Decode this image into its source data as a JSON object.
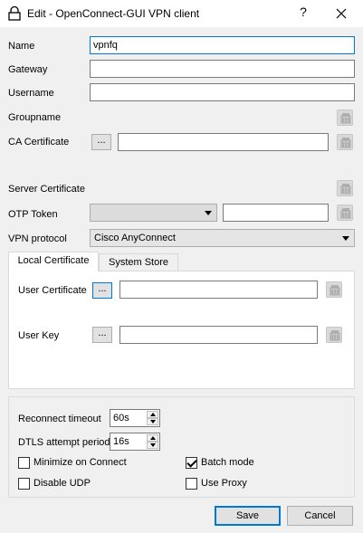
{
  "window": {
    "title": "Edit - OpenConnect-GUI VPN client",
    "help_label": "?"
  },
  "form": {
    "name_label": "Name",
    "name_value": "vpnfq",
    "gateway_label": "Gateway",
    "gateway_value": "",
    "username_label": "Username",
    "username_value": "",
    "groupname_label": "Groupname",
    "ca_certificate_label": "CA Certificate",
    "ca_certificate_value": "",
    "browse_label": "...",
    "server_certificate_label": "Server Certificate",
    "otp_token_label": "OTP Token",
    "otp_token_type": "",
    "otp_token_value": "",
    "vpn_protocol_label": "VPN protocol",
    "vpn_protocol_value": "Cisco AnyConnect"
  },
  "tabs": [
    {
      "label": "Local Certificate",
      "active": true
    },
    {
      "label": "System Store",
      "active": false
    }
  ],
  "local_certificate": {
    "user_certificate_label": "User Certificate",
    "user_certificate_value": "",
    "user_key_label": "User Key",
    "user_key_value": ""
  },
  "options": {
    "reconnect_timeout_label": "Reconnect timeout",
    "reconnect_timeout_value": "60s",
    "dtls_attempt_label": "DTLS attempt period",
    "dtls_attempt_value": "16s",
    "minimize_on_connect_label": "Minimize on Connect",
    "minimize_on_connect": false,
    "batch_mode_label": "Batch mode",
    "batch_mode": true,
    "disable_udp_label": "Disable UDP",
    "disable_udp": false,
    "use_proxy_label": "Use Proxy",
    "use_proxy": false
  },
  "buttons": {
    "save_label": "Save",
    "cancel_label": "Cancel"
  },
  "icons": {
    "window_icon": "lock-icon",
    "clear_icon": "eraser-icon"
  },
  "colors": {
    "accent": "#0078d7",
    "background": "#f0f0f0"
  }
}
